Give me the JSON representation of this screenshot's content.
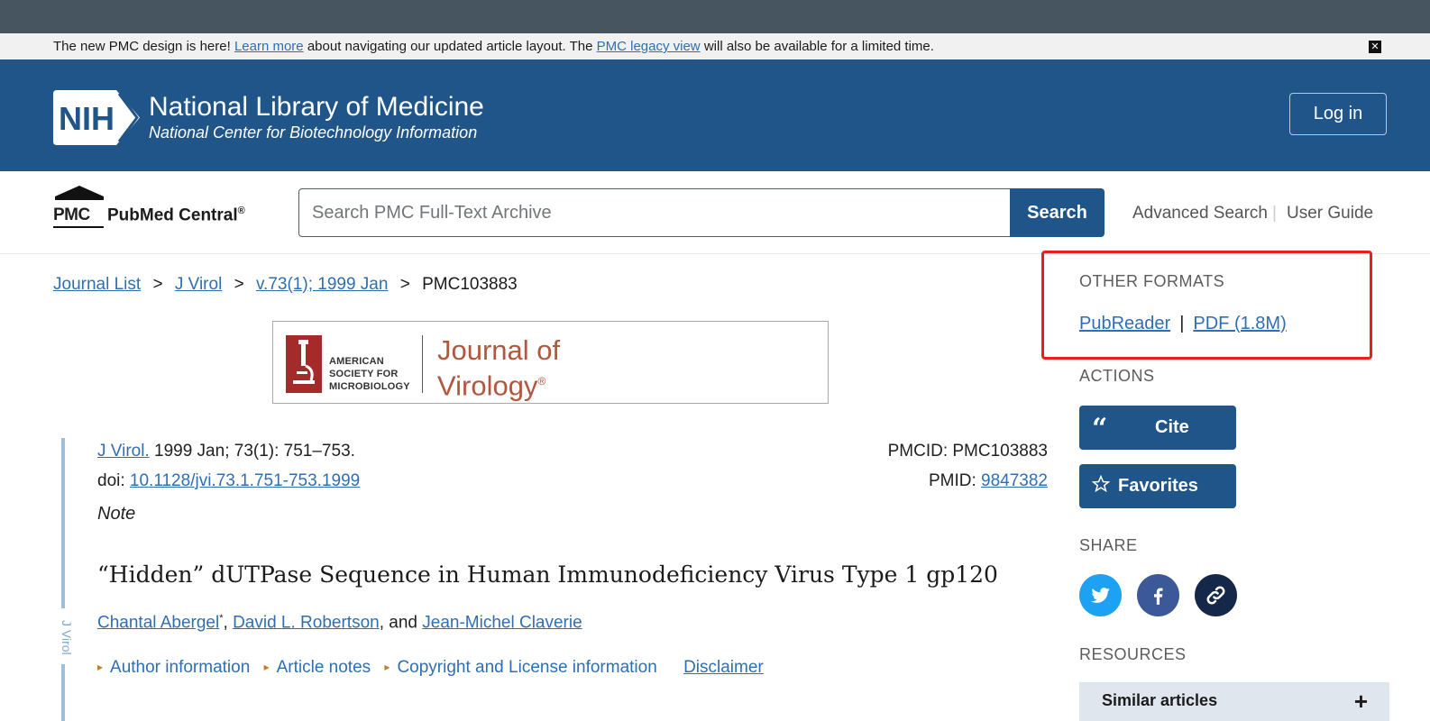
{
  "banner": {
    "text_before": "The new PMC design is here! ",
    "learn_more": "Learn more",
    "text_middle": " about navigating our updated article layout. The ",
    "legacy_view": "PMC legacy view",
    "text_after": " will also be available for a limited time.",
    "close_symbol": "✕"
  },
  "header": {
    "logo_text": "NIH",
    "title": "National Library of Medicine",
    "subtitle": "National Center for Biotechnology Information",
    "login_label": "Log in"
  },
  "searchbar": {
    "pmc_abbrev": "PMC",
    "pmc_name": "PubMed Central",
    "pmc_reg": "®",
    "placeholder": "Search PMC Full-Text Archive",
    "search_label": "Search",
    "advanced_search": "Advanced Search",
    "separator": "|",
    "user_guide": "User Guide"
  },
  "breadcrumb": {
    "items": [
      "Journal List",
      "J Virol",
      "v.73(1); 1999 Jan"
    ],
    "current": "PMC103883",
    "sep": ">"
  },
  "journal_banner": {
    "society_line1": "AMERICAN",
    "society_line2": "SOCIETY FOR",
    "society_line3": "MICROBIOLOGY",
    "journal_line1": "Journal of",
    "journal_line2": "Virology",
    "journal_reg": "®"
  },
  "article": {
    "side_label": "J Virol",
    "journal_abbrev": "J Virol.",
    "citation": " 1999 Jan; 73(1): 751–753.",
    "doi_label": "doi: ",
    "doi": "10.1128/jvi.73.1.751-753.1999",
    "pmcid_label": "PMCID: ",
    "pmcid": "PMC103883",
    "pmid_label": "PMID: ",
    "pmid": "9847382",
    "note": "Note",
    "title": "“Hidden” dUTPase Sequence in Human Immunodeficiency Virus Type 1 gp120",
    "authors": [
      "Chantal Abergel",
      "David L. Robertson",
      "Jean-Michel Claverie"
    ],
    "author_mark": "*",
    "author_and": ", and ",
    "author_comma": ", ",
    "meta_links": [
      "Author information",
      "Article notes",
      "Copyright and License information"
    ],
    "disclaimer": "Disclaimer"
  },
  "sidebar": {
    "other_formats_heading": "OTHER FORMATS",
    "pubreader": "PubReader",
    "format_sep": "|",
    "pdf": "PDF (1.8M)",
    "actions_heading": "ACTIONS",
    "cite_label": "Cite",
    "favorites_label": "Favorites",
    "share_heading": "SHARE",
    "resources_heading": "RESOURCES",
    "similar_articles": "Similar articles",
    "expand_symbol": "+"
  },
  "colors": {
    "brand_blue": "#20558a",
    "link": "#2f6fb1",
    "highlight_box": "#ee1c1c",
    "twitter": "#1da1f2",
    "facebook": "#3b5998",
    "link_share": "#16284a"
  },
  "icons": {
    "cite": "quote-icon",
    "favorites": "star-outline-icon",
    "share": [
      "twitter-icon",
      "facebook-icon",
      "link-icon"
    ]
  }
}
